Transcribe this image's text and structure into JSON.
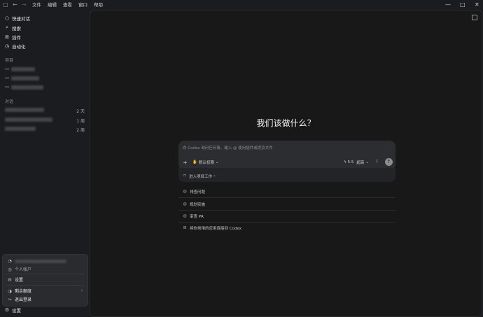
{
  "titlebar": {
    "menus": [
      "文件",
      "编辑",
      "查看",
      "窗口",
      "帮助"
    ]
  },
  "sidebar": {
    "nav": [
      {
        "label": "快速对话",
        "icon": "chat-bubble-icon"
      },
      {
        "label": "搜索",
        "icon": "search-icon"
      },
      {
        "label": "插件",
        "icon": "grid-icon"
      },
      {
        "label": "自动化",
        "icon": "clock-icon"
      }
    ],
    "projects_label": "项目",
    "conversations_label": "对话",
    "conversations": [
      {
        "time": "2 天"
      },
      {
        "time": "1 周"
      },
      {
        "time": "2 周"
      }
    ],
    "account_popup": {
      "account_type": "个人帐户",
      "settings": "设置",
      "remaining_quota": "剩余额度",
      "logout": "退出登录"
    },
    "bottom_settings": "设置"
  },
  "main": {
    "headline": "我们该做什么？",
    "composer": {
      "placeholder": "向 Codex 询问任何事。输入 @ 使用插件或提及文件",
      "permission": "默认权限",
      "model": "5.5",
      "effort": "超高"
    },
    "project_work": "进入项目工作",
    "suggestions": [
      {
        "label": "排查问题",
        "icon": "github-icon"
      },
      {
        "label": "规划实施",
        "icon": "github-icon"
      },
      {
        "label": "审查 PR",
        "icon": "github-icon"
      },
      {
        "label": "将你常用的应用连接到 Codex",
        "icon": "grid-icon"
      }
    ]
  }
}
